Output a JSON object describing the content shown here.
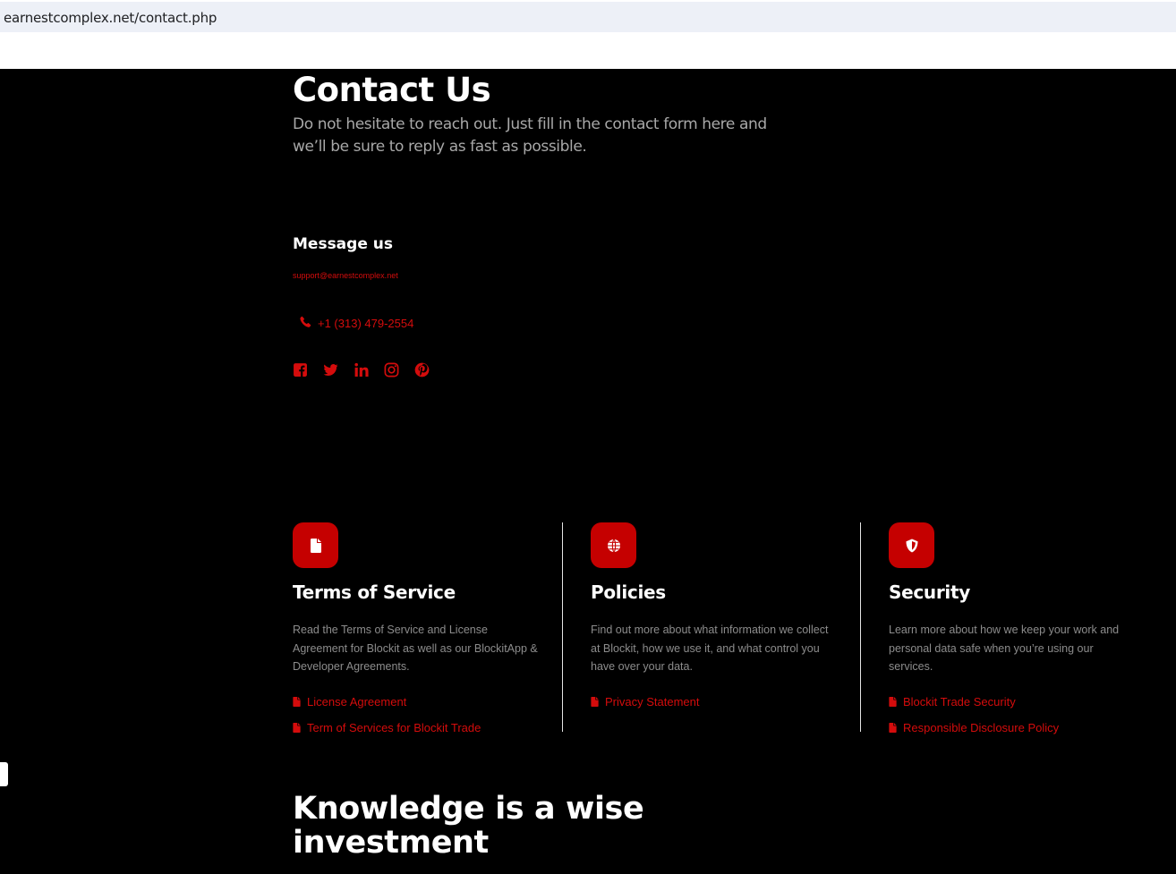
{
  "browser": {
    "url": "earnestcomplex.net/contact.php"
  },
  "hero": {
    "title": "Contact Us",
    "subtitle": "Do not hesitate to reach out. Just fill in the contact form here and we’ll be sure to reply as fast as possible."
  },
  "contact": {
    "heading": "Message us",
    "email": "support@earnestcomplex.net",
    "phone": "+1 (313) 479-2554",
    "social_icons": [
      "facebook-icon",
      "twitter-icon",
      "linkedin-icon",
      "instagram-icon",
      "pinterest-icon"
    ]
  },
  "columns": [
    {
      "icon": "document-icon",
      "title": "Terms of Service",
      "text": "Read the Terms of Service and License Agreement for Blockit as well as our BlockitApp & Developer Agreements.",
      "links": [
        "License Agreement",
        "Term of Services for Blockit Trade"
      ]
    },
    {
      "icon": "globe-icon",
      "title": "Policies",
      "text": "Find out more about what information we collect at Blockit, how we use it, and what control you have over your data.",
      "links": [
        "Privacy Statement"
      ]
    },
    {
      "icon": "shield-icon",
      "title": "Security",
      "text": "Learn more about how we keep your work and personal data safe when you’re using our services.",
      "links": [
        "Blockit Trade Security",
        "Responsible Disclosure Policy"
      ]
    }
  ],
  "knowledge": {
    "highlight": "Knowledge",
    "rest_line1": " is a wise",
    "line2": "investment"
  },
  "colors": {
    "accent": "#d40c0c",
    "icon_bg": "#c50000",
    "background": "#000000",
    "text_muted": "#8c8c8c"
  }
}
